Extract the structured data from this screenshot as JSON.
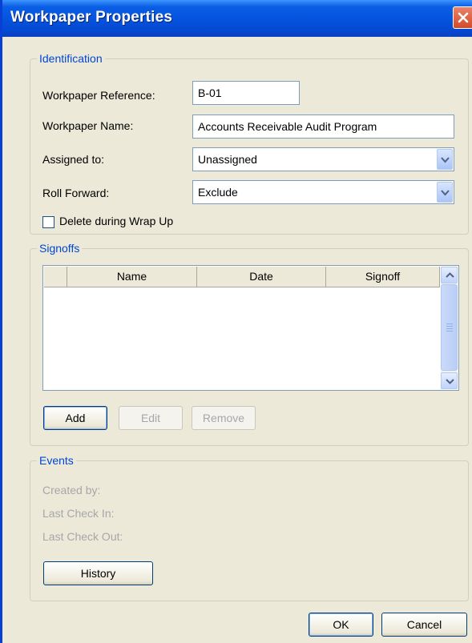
{
  "window": {
    "title": "Workpaper Properties",
    "close_icon": "close-icon"
  },
  "identification": {
    "legend": "Identification",
    "reference_label": "Workpaper Reference:",
    "reference_value": "B-01",
    "name_label": "Workpaper Name:",
    "name_value": "Accounts Receivable Audit Program",
    "assigned_label": "Assigned to:",
    "assigned_value": "Unassigned",
    "roll_label": "Roll Forward:",
    "roll_value": "Exclude",
    "delete_label": "Delete during Wrap Up",
    "delete_checked": false
  },
  "signoffs": {
    "legend": "Signoffs",
    "columns": [
      "Name",
      "Date",
      "Signoff"
    ],
    "rows": [],
    "add_label": "Add",
    "edit_label": "Edit",
    "remove_label": "Remove"
  },
  "events": {
    "legend": "Events",
    "created_by_label": "Created by:",
    "last_check_in_label": "Last Check In:",
    "last_check_out_label": "Last Check Out:",
    "history_label": "History"
  },
  "footer": {
    "ok_label": "OK",
    "cancel_label": "Cancel"
  },
  "colors": {
    "title_bar": "#0554e0",
    "legend_text": "#0046d5",
    "dialog_bg": "#ece9d8",
    "close_button": "#d34a2a"
  }
}
